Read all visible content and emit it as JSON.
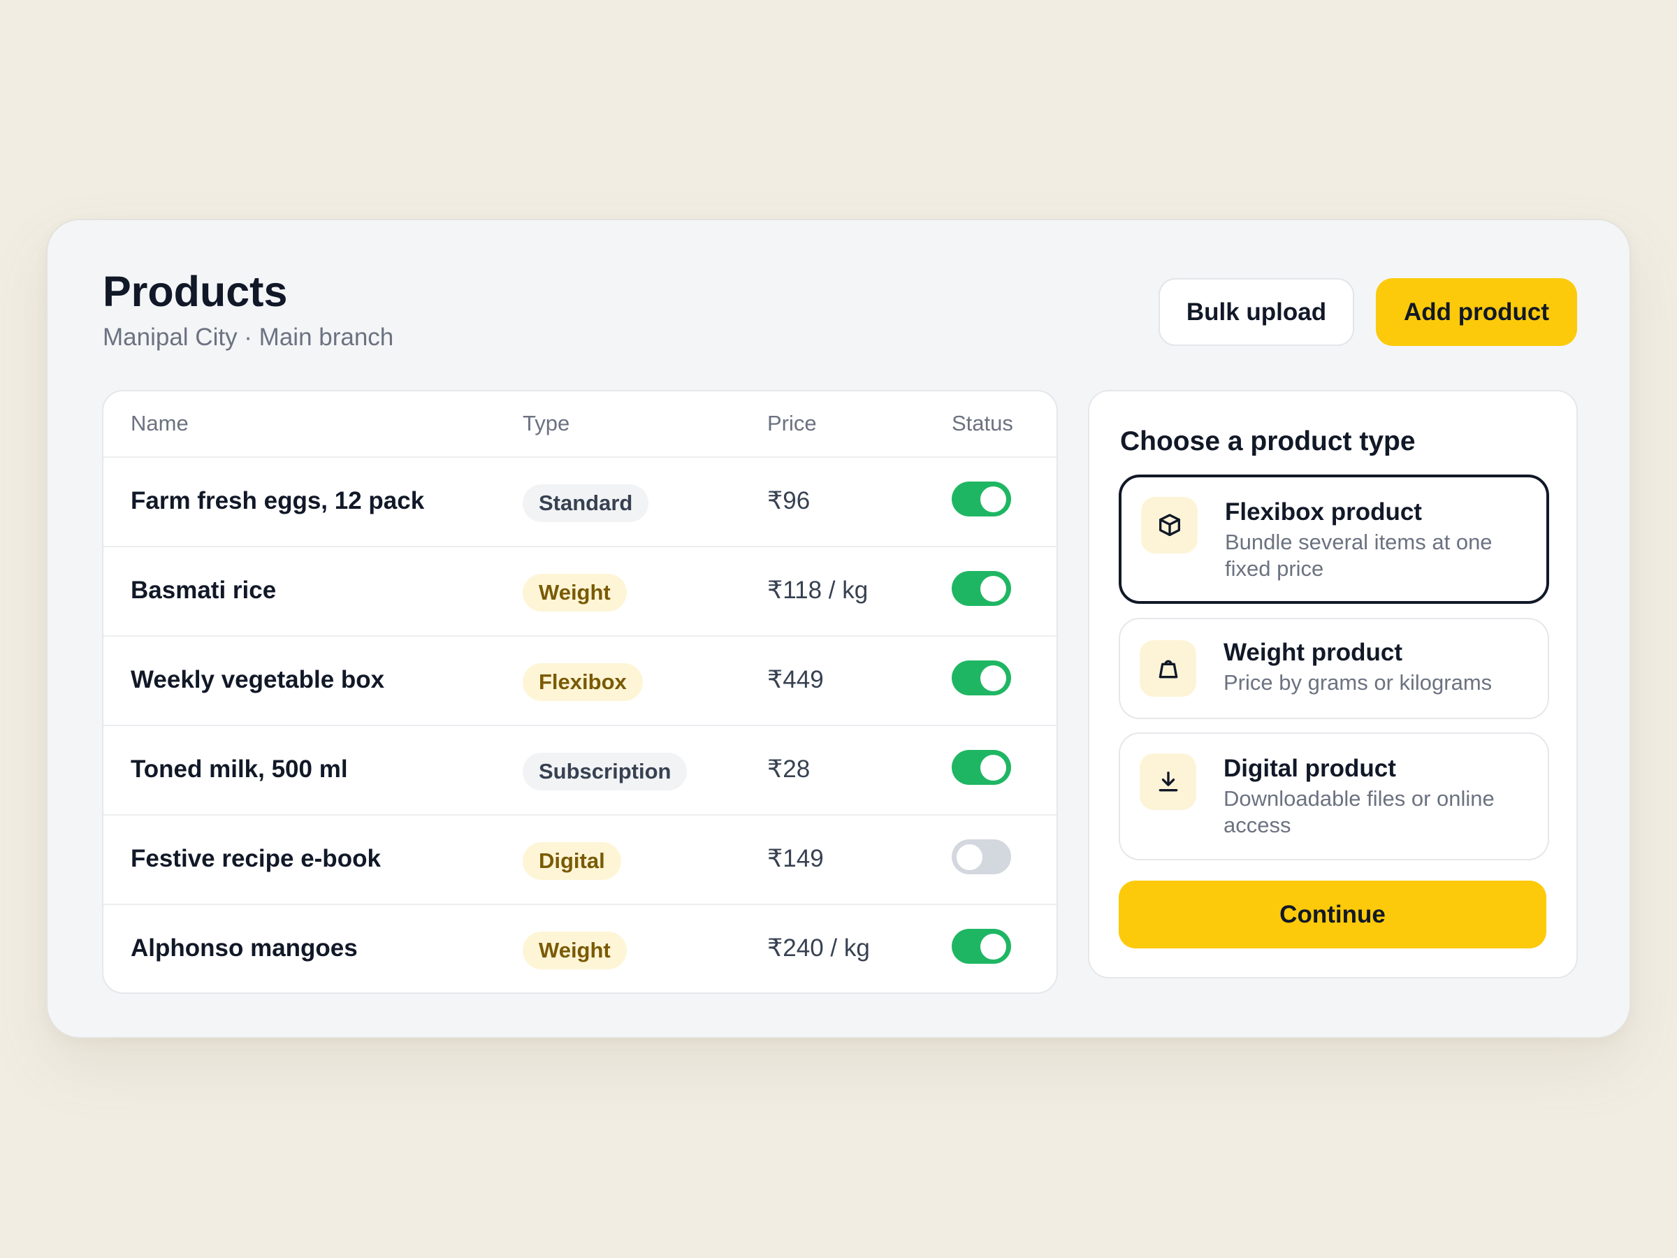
{
  "header": {
    "title": "Products",
    "subtitle": "Manipal City · Main branch",
    "bulk_upload_label": "Bulk upload",
    "add_product_label": "Add product"
  },
  "table": {
    "columns": [
      "Name",
      "Type",
      "Price",
      "Status"
    ],
    "rows": [
      {
        "name": "Farm fresh eggs, 12 pack",
        "type": "Standard",
        "price": "₹96",
        "status": "on"
      },
      {
        "name": "Basmati rice",
        "type": "Weight",
        "price": "₹118 / kg",
        "status": "on"
      },
      {
        "name": "Weekly vegetable box",
        "type": "Flexibox",
        "price": "₹449",
        "status": "on"
      },
      {
        "name": "Toned milk, 500 ml",
        "type": "Subscription",
        "price": "₹28",
        "status": "on"
      },
      {
        "name": "Festive recipe e-book",
        "type": "Digital",
        "price": "₹149",
        "status": "off"
      },
      {
        "name": "Alphonso mangoes",
        "type": "Weight",
        "price": "₹240 / kg",
        "status": "on"
      }
    ]
  },
  "product_type_panel": {
    "title": "Choose a product type",
    "options": [
      {
        "title": "Flexibox product",
        "description": "Bundle several items at one fixed price",
        "icon": "box-icon",
        "selected": true
      },
      {
        "title": "Weight product",
        "description": "Price by grams or kilograms",
        "icon": "weight-icon",
        "selected": false
      },
      {
        "title": "Digital product",
        "description": "Downloadable files or online access",
        "icon": "download-icon",
        "selected": false
      }
    ],
    "continue_label": "Continue"
  },
  "colors": {
    "accent": "#fcca0a",
    "toggle_on": "#1fb663",
    "toggle_off": "#d3d7de",
    "background": "#f1ede3"
  }
}
